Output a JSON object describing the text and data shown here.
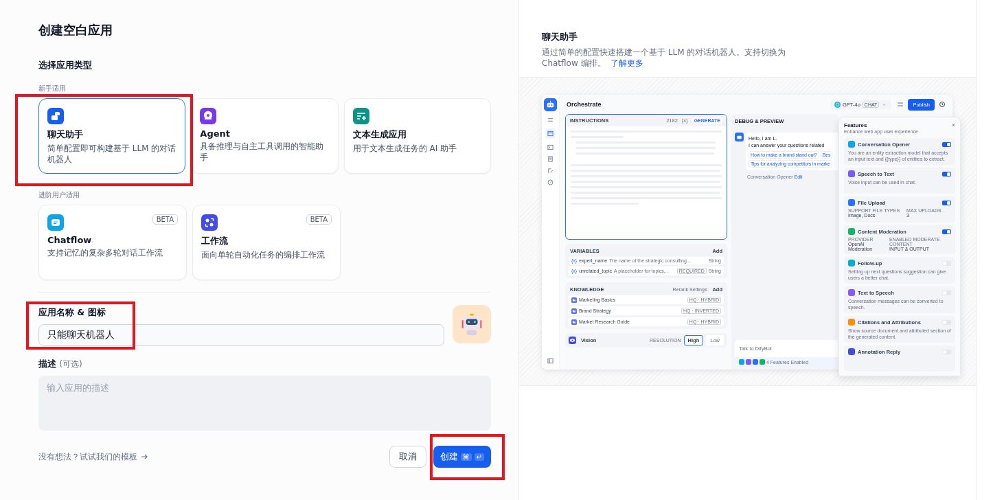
{
  "title": "创建空白应用",
  "type_label": "选择应用类型",
  "groups": [
    {
      "label": "新手适用",
      "cards": [
        {
          "kind": "chat",
          "title": "聊天助手",
          "description": "简单配置即可构建基于 LLM 的对话机器人",
          "selected": true
        },
        {
          "kind": "agent",
          "title": "Agent",
          "description": "具备推理与自主工具调用的智能助手",
          "selected": false
        },
        {
          "kind": "text",
          "title": "文本生成应用",
          "description": "用于文本生成任务的 AI 助手",
          "selected": false
        }
      ]
    },
    {
      "label": "进阶用户适用",
      "cards": [
        {
          "kind": "chatflow",
          "title": "Chatflow",
          "description": "支持记忆的复杂多轮对话工作流",
          "badge": "BETA",
          "selected": false
        },
        {
          "kind": "workflow",
          "title": "工作流",
          "description": "面向单轮自动化任务的编排工作流",
          "badge": "BETA",
          "selected": false
        }
      ]
    }
  ],
  "name_field": {
    "label": "应用名称 & 图标",
    "value": "只能聊天机器人"
  },
  "description_field": {
    "label": "描述",
    "hint": "(可选)",
    "placeholder": "输入应用的描述"
  },
  "template_link": "没有想法？试试我们的模板",
  "cancel_button": "取消",
  "create_button": {
    "label": "创建",
    "keys": [
      "⌘",
      "↵"
    ]
  },
  "highlights": [
    {
      "kind": "app_type"
    },
    {
      "kind": "app_name"
    },
    {
      "kind": "create"
    }
  ],
  "info": {
    "title": "聊天助手",
    "description": "通过简单的配置快速搭建一个基于 LLM 的对话机器人。支持切换为 Chatflow 编排。",
    "link": "了解更多"
  },
  "preview": {
    "title": "Orchestrate",
    "model": {
      "name": "GPT-4o",
      "tag": "CHAT"
    },
    "publish": "Publish",
    "instructions": {
      "label": "INSTRUCTIONS",
      "count": "2182",
      "variable": "{x}",
      "generate": "GENERATE"
    },
    "variables": {
      "label": "VARIABLES",
      "add": "Add",
      "items": [
        {
          "mark": "{x}",
          "name": "expert_name",
          "description": "The name of the strategic consulting...",
          "type": "String"
        },
        {
          "mark": "{x}",
          "name": "unrelated_topic",
          "description": "A placeholder for topics...",
          "required": "REQUIRED",
          "type": "String"
        }
      ]
    },
    "knowledge": {
      "label": "KNOWLEDGE",
      "rerank": "Rerank Settings",
      "add": "Add",
      "items": [
        {
          "name": "Marketing Basics",
          "tag": "HQ · HYBRID"
        },
        {
          "name": "Brand Strategy",
          "tag": "HQ · INVERTED"
        },
        {
          "name": "Market Research Guide",
          "tag": "HQ · HYBRID"
        }
      ]
    },
    "vision": {
      "label": "Vision",
      "resolution": "RESOLUTION",
      "options": [
        {
          "label": "High",
          "selected": true
        },
        {
          "label": "Low",
          "selected": false
        }
      ]
    },
    "debug": {
      "title": "DEBUG & PREVIEW",
      "greeting": [
        "Hello, I am L.",
        "I can answer your questions related"
      ],
      "suggestions": [
        "How to make a brand stand out?",
        "Bes",
        "Tips for analyzing competitors in marke"
      ],
      "opener": "Conversation Opener",
      "edit": "Edit",
      "input_placeholder": "Talk to DifyBot",
      "features_enabled": "4 Features Enabled"
    },
    "features": {
      "title": "Features",
      "subtitle": "Enhance web app user experience",
      "close": "×",
      "items": [
        {
          "name": "Conversation Opener",
          "on": true,
          "color": "#0ba5ec",
          "description": "You are an entity extraction model that accepts an input text and {{type}} of entities to extract."
        },
        {
          "name": "Speech to Text",
          "on": true,
          "color": "#7a5af8",
          "description": "Voice input can be used in chat."
        },
        {
          "name": "File Upload",
          "on": true,
          "color": "#2970ff",
          "fields": [
            {
              "label": "SUPPORT FILE TYPES",
              "value": "Image, Docs"
            },
            {
              "label": "MAX UPLOADS",
              "value": "3"
            }
          ]
        },
        {
          "name": "Content Moderation",
          "on": true,
          "color": "#16b364",
          "fields": [
            {
              "label": "PROVIDER",
              "value": "OpenAI Moderation"
            },
            {
              "label": "ENABLED MODERATE CONTENT",
              "value": "INPUT & OUTPUT"
            }
          ]
        },
        {
          "name": "Follow-up",
          "on": false,
          "color": "#06aed4",
          "description": "Setting up next questions suggestion can give users a better chat."
        },
        {
          "name": "Text to Speech",
          "on": false,
          "color": "#875bf7",
          "description": "Conversation messages can be converted to speech."
        },
        {
          "name": "Citations and Attributions",
          "on": false,
          "color": "#f79009",
          "description": "Show source document and attributed section of the generated content."
        },
        {
          "name": "Annotation Reply",
          "on": false,
          "color": "#444ce7"
        }
      ]
    }
  }
}
